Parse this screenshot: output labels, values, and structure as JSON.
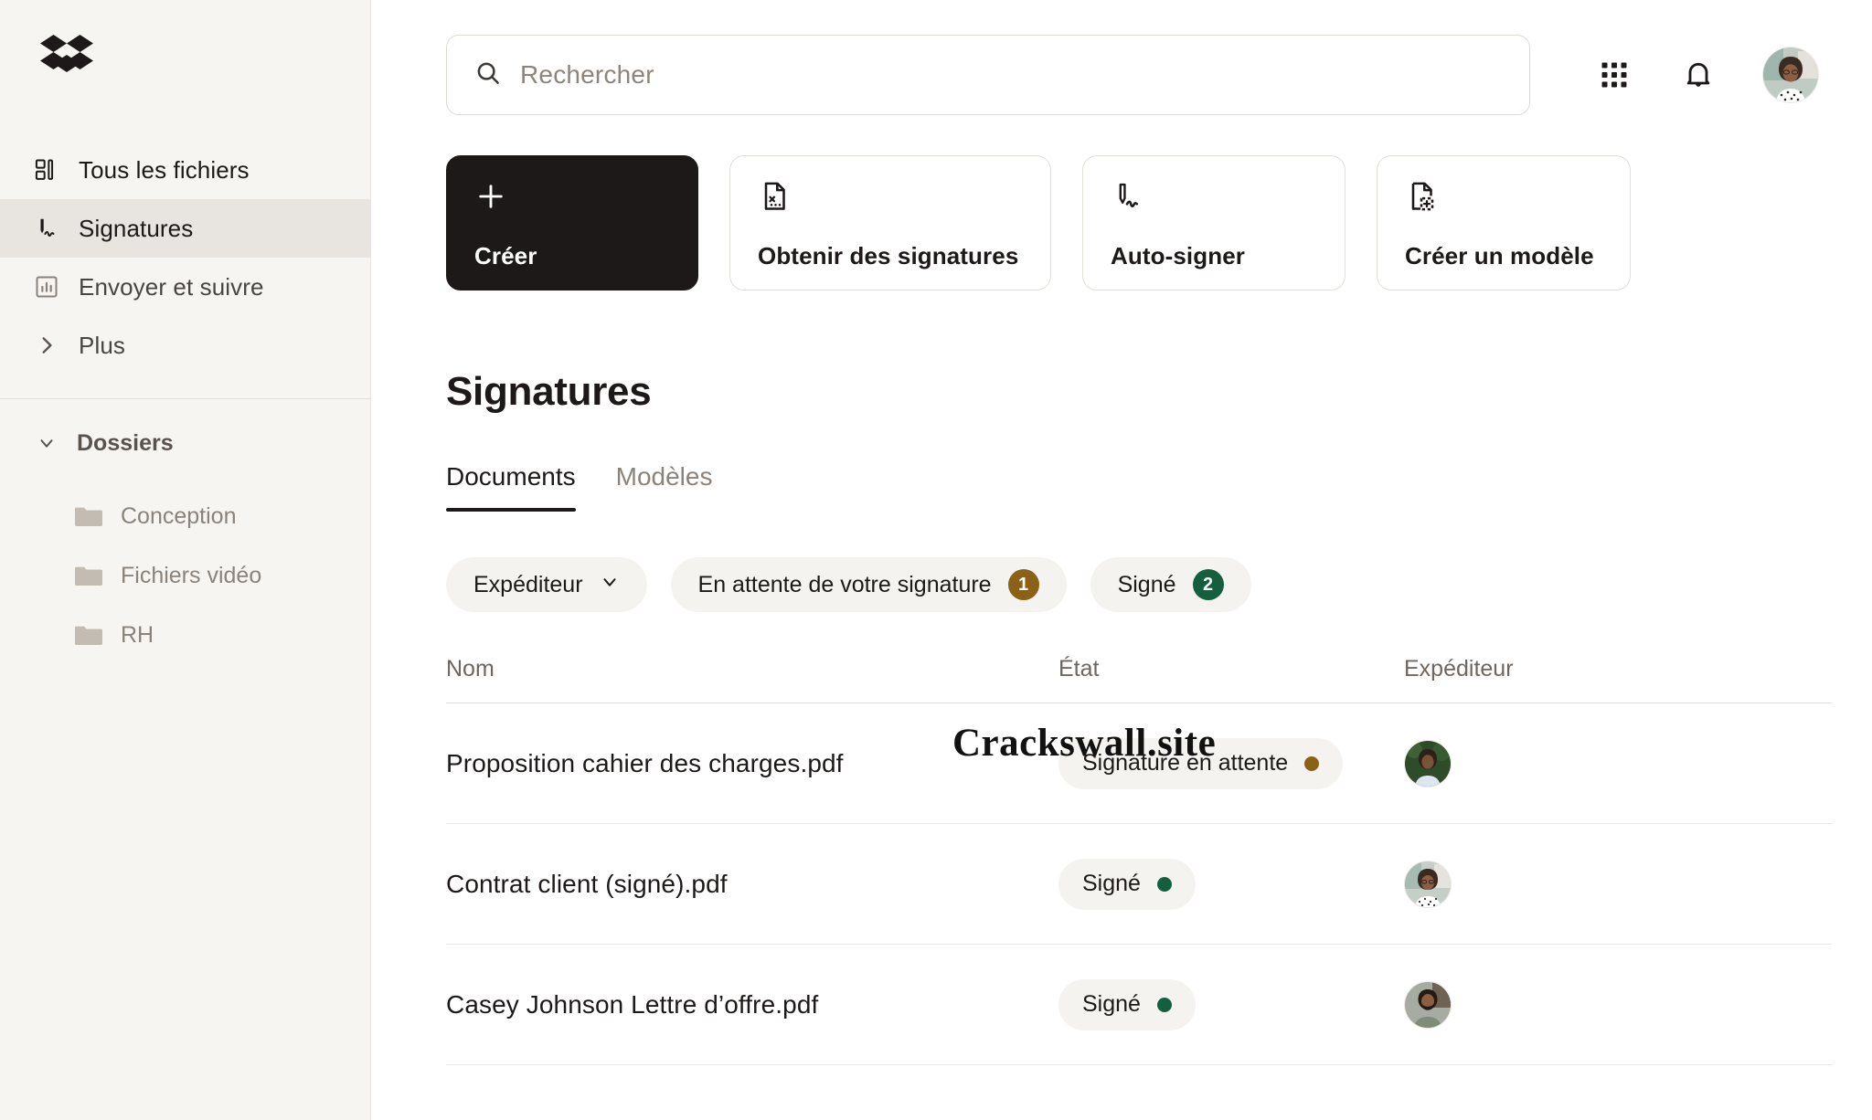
{
  "brand": {
    "logo_name": "dropbox-logo",
    "logo_color": "#1E1919"
  },
  "colors": {
    "sidebar_bg": "#F7F5F2",
    "accent_dark": "#1E1919",
    "pending_amber": "#8A6116",
    "signed_green": "#14603E",
    "pill_bg": "#F5F3EF"
  },
  "sidebar": {
    "items": [
      {
        "label": "Tous les fichiers",
        "icon": "all-files-icon",
        "active": false
      },
      {
        "label": "Signatures",
        "icon": "signature-icon",
        "active": true
      },
      {
        "label": "Envoyer et suivre",
        "icon": "send-track-icon",
        "active": false
      },
      {
        "label": "Plus",
        "icon": "chevron-right-icon",
        "active": false
      }
    ],
    "folders_section": {
      "label": "Dossiers",
      "expanded": true,
      "items": [
        {
          "label": "Conception"
        },
        {
          "label": "Fichiers vidéo"
        },
        {
          "label": "RH"
        }
      ]
    }
  },
  "topbar": {
    "search": {
      "placeholder": "Rechercher",
      "value": ""
    },
    "grid_icon": "apps-grid-icon",
    "bell_icon": "notification-bell-icon",
    "avatar": "user-avatar"
  },
  "actions": [
    {
      "label": "Créer",
      "icon": "plus-icon",
      "primary": true
    },
    {
      "label": "Obtenir des signatures",
      "icon": "request-signature-doc-icon",
      "primary": false
    },
    {
      "label": "Auto-signer",
      "icon": "pen-sign-icon",
      "primary": false
    },
    {
      "label": "Créer un modèle",
      "icon": "new-template-doc-icon",
      "primary": false
    }
  ],
  "page": {
    "title": "Signatures"
  },
  "tabs": [
    {
      "label": "Documents",
      "active": true
    },
    {
      "label": "Modèles",
      "active": false
    }
  ],
  "filters": [
    {
      "label": "Expéditeur",
      "type": "dropdown",
      "icon": "chevron-down-icon"
    },
    {
      "label": "En attente de votre signature",
      "badge": "1",
      "badge_color": "#8A6116"
    },
    {
      "label": "Signé",
      "badge": "2",
      "badge_color": "#14603E"
    }
  ],
  "table": {
    "headers": {
      "name": "Nom",
      "state": "État",
      "sender": "Expéditeur"
    },
    "rows": [
      {
        "name": "Proposition cahier des charges.pdf",
        "state": "Signature en attente",
        "state_dot": "#8A6116",
        "sender_avatar": "avatar-man-outdoors"
      },
      {
        "name": "Contrat client (signé).pdf",
        "state": "Signé",
        "state_dot": "#14603E",
        "sender_avatar": "avatar-woman-glasses"
      },
      {
        "name": "Casey Johnson Lettre d’offre.pdf",
        "state": "Signé",
        "state_dot": "#14603E",
        "sender_avatar": "avatar-man-beard"
      }
    ]
  },
  "watermark": {
    "text": "Crackswall.site"
  }
}
